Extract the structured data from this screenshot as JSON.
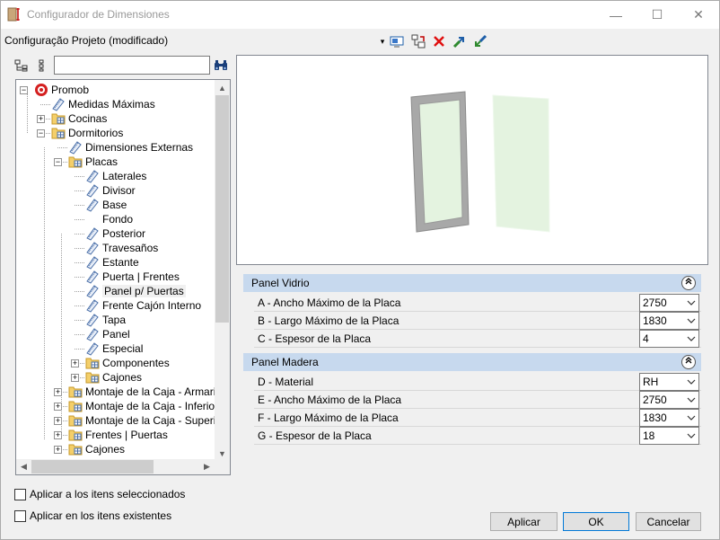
{
  "window": {
    "title": "Configurador de Dimensiones",
    "minimize_glyph": "—",
    "maximize_glyph": "☐",
    "close_glyph": "✕"
  },
  "toolbar": {
    "project_label": "Configuração Projeto (modificado)",
    "dropdown_glyph": "▾",
    "icons": [
      "monitor-icon",
      "copy-structure-icon",
      "delete-icon",
      "export-icon",
      "import-icon"
    ]
  },
  "tree": {
    "search_value": "",
    "nodes": [
      {
        "label": "Promob",
        "icon": "promob-logo-icon",
        "depth": 0,
        "expander": "−"
      },
      {
        "label": "Medidas Máximas",
        "icon": "tag-icon",
        "depth": 1,
        "expander": ""
      },
      {
        "label": "Cocinas",
        "icon": "folder-icon",
        "depth": 1,
        "expander": "+"
      },
      {
        "label": "Dormitorios",
        "icon": "folder-icon",
        "depth": 1,
        "expander": "−"
      },
      {
        "label": "Dimensiones Externas",
        "icon": "tag-icon",
        "depth": 2,
        "expander": ""
      },
      {
        "label": "Placas",
        "icon": "folder-icon",
        "depth": 2,
        "expander": "−"
      },
      {
        "label": "Laterales",
        "icon": "tag-icon",
        "depth": 3,
        "expander": ""
      },
      {
        "label": "Divisor",
        "icon": "tag-icon",
        "depth": 3,
        "expander": ""
      },
      {
        "label": "Base",
        "icon": "tag-icon",
        "depth": 3,
        "expander": ""
      },
      {
        "label": "Fondo",
        "icon": "",
        "depth": 3,
        "expander": ""
      },
      {
        "label": "Posterior",
        "icon": "tag-icon",
        "depth": 3,
        "expander": ""
      },
      {
        "label": "Travesaños",
        "icon": "tag-icon",
        "depth": 3,
        "expander": ""
      },
      {
        "label": "Estante",
        "icon": "tag-icon",
        "depth": 3,
        "expander": ""
      },
      {
        "label": "Puerta | Frentes",
        "icon": "tag-icon",
        "depth": 3,
        "expander": ""
      },
      {
        "label": "Panel p/ Puertas",
        "icon": "tag-icon",
        "depth": 3,
        "expander": "",
        "selected": true
      },
      {
        "label": "Frente Cajón Interno",
        "icon": "tag-icon",
        "depth": 3,
        "expander": ""
      },
      {
        "label": "Tapa",
        "icon": "tag-icon",
        "depth": 3,
        "expander": ""
      },
      {
        "label": "Panel",
        "icon": "tag-icon",
        "depth": 3,
        "expander": ""
      },
      {
        "label": "Especial",
        "icon": "tag-icon",
        "depth": 3,
        "expander": ""
      },
      {
        "label": "Componentes",
        "icon": "folder-icon",
        "depth": 3,
        "expander": "+"
      },
      {
        "label": "Cajones",
        "icon": "folder-icon",
        "depth": 3,
        "expander": "+"
      },
      {
        "label": "Montaje de la Caja - Armarios",
        "icon": "folder-icon",
        "depth": 2,
        "expander": "+"
      },
      {
        "label": "Montaje de la Caja - Inferiores",
        "icon": "folder-icon",
        "depth": 2,
        "expander": "+"
      },
      {
        "label": "Montaje de la Caja - Superior",
        "icon": "folder-icon",
        "depth": 2,
        "expander": "+"
      },
      {
        "label": "Frentes | Puertas",
        "icon": "folder-icon",
        "depth": 2,
        "expander": "+"
      },
      {
        "label": "Cajones",
        "icon": "folder-icon",
        "depth": 2,
        "expander": "+"
      }
    ]
  },
  "sections": [
    {
      "title": "Panel Vidrio",
      "rows": [
        {
          "label": "A -  Ancho Máximo de la Placa",
          "value": "2750"
        },
        {
          "label": "B - Largo Máximo de la Placa",
          "value": "1830"
        },
        {
          "label": "C - Espesor de la Placa",
          "value": "4"
        }
      ]
    },
    {
      "title": "Panel Madera",
      "rows": [
        {
          "label": "D - Material",
          "value": "RH"
        },
        {
          "label": "E -  Ancho Máximo de la Placa",
          "value": "2750"
        },
        {
          "label": "F - Largo Máximo de la Placa",
          "value": "1830"
        },
        {
          "label": "G - Espesor de la Placa",
          "value": "18"
        }
      ]
    }
  ],
  "options": {
    "apply_selected": "Aplicar a los itens seleccionados",
    "apply_existing": "Aplicar en los itens existentes"
  },
  "buttons": {
    "apply": "Aplicar",
    "ok": "OK",
    "cancel": "Cancelar"
  },
  "colors": {
    "section_header": "#c7d9ee",
    "glass_tint": "#e4f3e0",
    "frame_gray": "#a8a8a8",
    "accent_blue": "#0078d7"
  }
}
